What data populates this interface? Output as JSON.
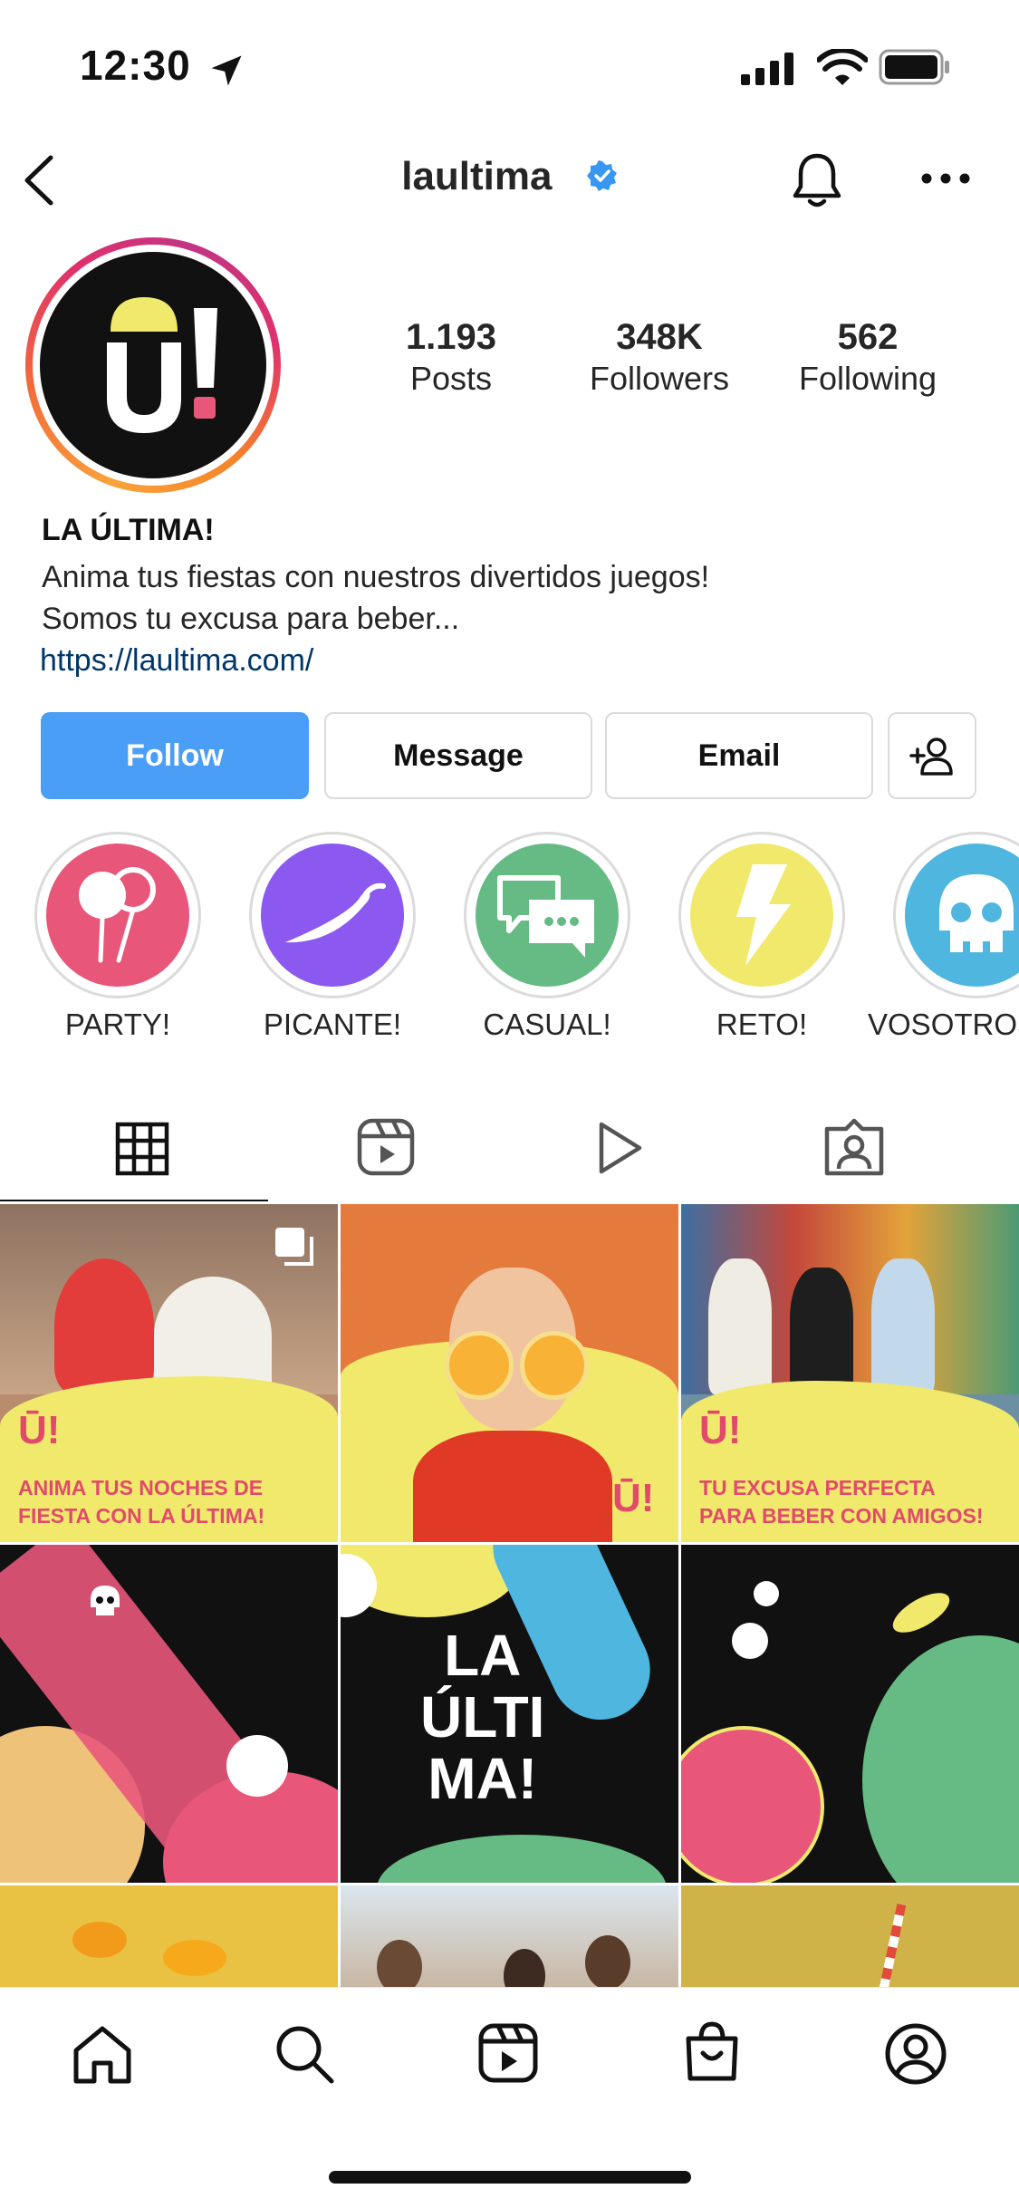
{
  "status_bar": {
    "time": "12:30"
  },
  "header": {
    "username": "laultima",
    "verified": true
  },
  "profile": {
    "stats": [
      {
        "value": "1.193",
        "label": "Posts"
      },
      {
        "value": "348K",
        "label": "Followers"
      },
      {
        "value": "562",
        "label": "Following"
      }
    ],
    "bio": {
      "name": "LA ÚLTIMA!",
      "lines": [
        "Anima tus fiestas con nuestros divertidos juegos!",
        "Somos tu excusa para beber..."
      ],
      "link": "https://laultima.com/"
    }
  },
  "actions": {
    "follow": "Follow",
    "message": "Message",
    "email": "Email"
  },
  "highlights": [
    {
      "label": "PARTY!",
      "color": "#e8567a",
      "icon": "balloons-icon"
    },
    {
      "label": "PICANTE!",
      "color": "#8b59f0",
      "icon": "chili-pepper-icon"
    },
    {
      "label": "CASUAL!",
      "color": "#66bb85",
      "icon": "chat-bubbles-icon"
    },
    {
      "label": "RETO!",
      "color": "#f1e96c",
      "icon": "lightning-icon"
    },
    {
      "label": "VOSOTROS!",
      "color": "#4fb6e0",
      "icon": "skull-icon"
    }
  ],
  "tabs": [
    "grid-tab",
    "reels-tab",
    "video-tab",
    "tagged-tab"
  ],
  "posts": [
    {
      "caption": "ANIMA TUS NOCHES DE\nFIESTA CON LA ÚLTIMA!"
    },
    {
      "caption": ""
    },
    {
      "caption": "TU EXCUSA PERFECTA\nPARA BEBER CON AMIGOS!"
    },
    {
      "logo_text": "LA\nÚLTI\nMA!"
    }
  ],
  "colors": {
    "accent_blue": "#4a9ef5",
    "brand_yellow": "#f1e96c",
    "brand_pink": "#e8567a",
    "link_blue": "#00376b"
  }
}
